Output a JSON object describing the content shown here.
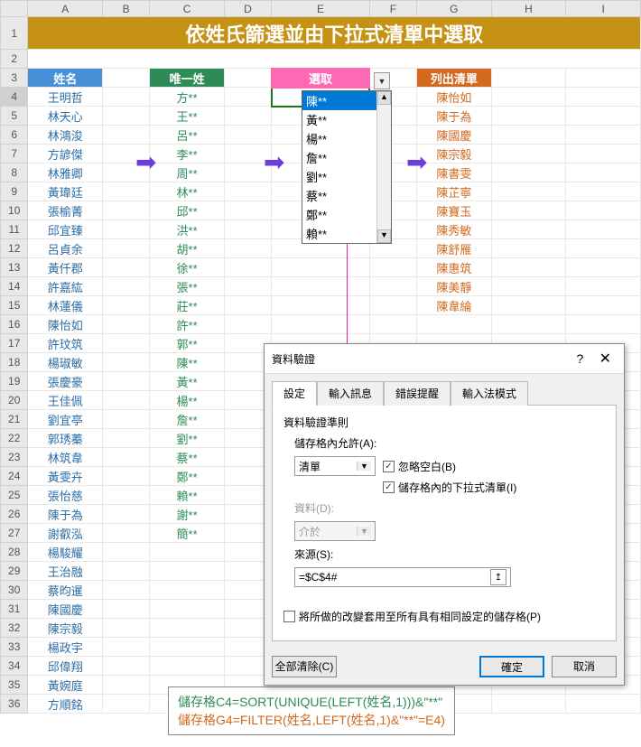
{
  "title": "依姓氏篩選並由下拉式清單中選取",
  "col_letters": [
    "A",
    "B",
    "C",
    "D",
    "E",
    "F",
    "G",
    "H",
    "I"
  ],
  "headers": {
    "name": "姓名",
    "unique": "唯一姓",
    "select": "選取",
    "list": "列出清單"
  },
  "selected_value": "陳**",
  "names": [
    "王明哲",
    "林天心",
    "林鴻浚",
    "方諺傑",
    "林雅卿",
    "黃瑋廷",
    "張榆菁",
    "邱宜臻",
    "呂貞余",
    "黃仟郡",
    "許嘉紘",
    "林蓮儀",
    "陳怡如",
    "許玟筑",
    "楊琡敏",
    "張慶豪",
    "王佳佩",
    "劉宜亭",
    "郭琇蓁",
    "林筑韋",
    "黃雯卉",
    "張怡慈",
    "陳于為",
    "謝叡泓",
    "楊駿耀",
    "王治融",
    "蔡昀暹",
    "陳國慶",
    "陳宗毅",
    "楊政宇",
    "邱偉翔",
    "黃婉庭",
    "方順銘"
  ],
  "unique_surnames": [
    "方**",
    "王**",
    "呂**",
    "李**",
    "周**",
    "林**",
    "邱**",
    "洪**",
    "胡**",
    "徐**",
    "張**",
    "莊**",
    "許**",
    "郭**",
    "陳**",
    "黃**",
    "楊**",
    "詹**",
    "劉**",
    "蔡**",
    "鄭**",
    "賴**",
    "謝**",
    "簡**"
  ],
  "dropdown_options": [
    "陳**",
    "黃**",
    "楊**",
    "詹**",
    "劉**",
    "蔡**",
    "鄭**",
    "賴**"
  ],
  "result_list": [
    "陳怡如",
    "陳于為",
    "陳國慶",
    "陳宗毅",
    "陳書雯",
    "陳芷寧",
    "陳寶玉",
    "陳秀敏",
    "陳舒雁",
    "陳惠筑",
    "陳美靜",
    "陳韋綸"
  ],
  "dialog": {
    "title": "資料驗證",
    "tabs": [
      "設定",
      "輸入訊息",
      "錯誤提醒",
      "輸入法模式"
    ],
    "rule_heading": "資料驗證準則",
    "allow_label": "儲存格內允許(A):",
    "allow_value": "清單",
    "data_label": "資料(D):",
    "data_value": "介於",
    "chk_ignore": "忽略空白(B)",
    "chk_dropdown": "儲存格內的下拉式清單(I)",
    "source_label": "來源(S):",
    "source_value": "=$C$4#",
    "apply_all": "將所做的改變套用至所有具有相同設定的儲存格(P)",
    "clear_btn": "全部清除(C)",
    "ok_btn": "確定",
    "cancel_btn": "取消"
  },
  "formulas": {
    "c4": "儲存格C4=SORT(UNIQUE(LEFT(姓名,1)))&\"**\"",
    "g4": "儲存格G4=FILTER(姓名,LEFT(姓名,1)&\"**\"=E4)"
  },
  "chart_data": {
    "type": "table",
    "title": "依姓氏篩選並由下拉式清單中選取",
    "columns": [
      "姓名",
      "唯一姓",
      "選取",
      "列出清單"
    ],
    "selected": "陳**",
    "source_formula": "=$C$4#"
  }
}
